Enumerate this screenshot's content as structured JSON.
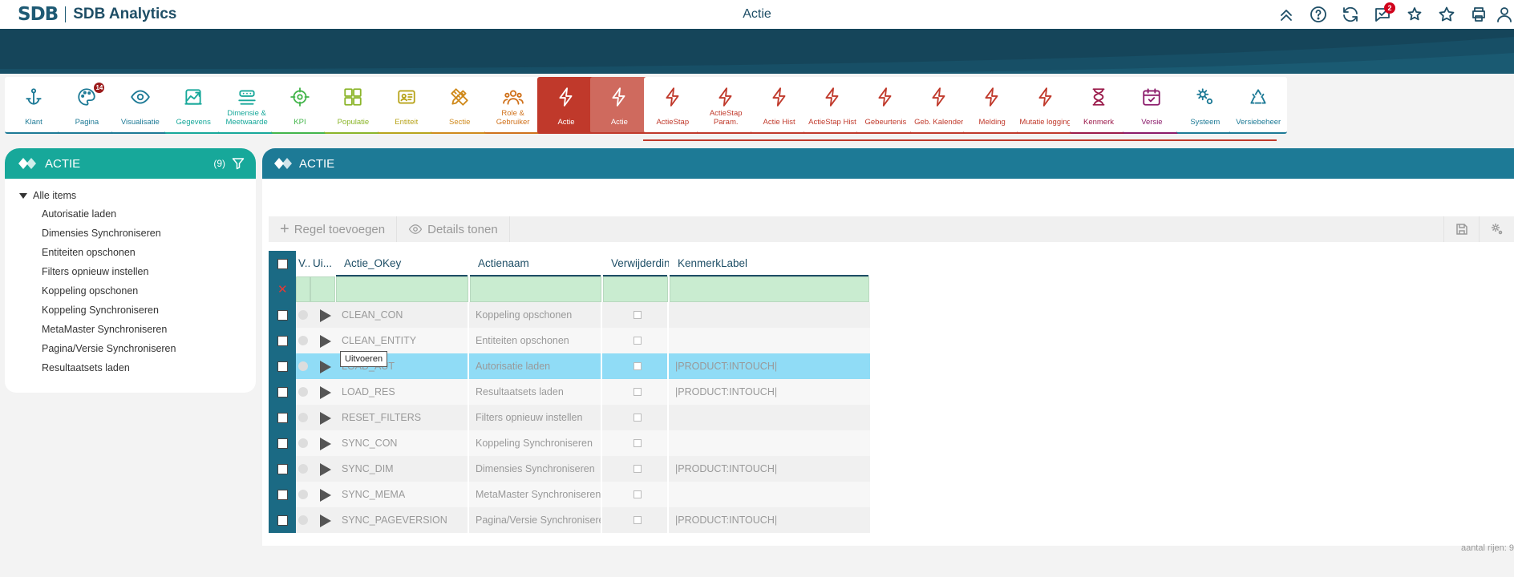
{
  "app": {
    "brand_mark": "SDB",
    "brand_name": "SDB Analytics",
    "page_title": "Actie"
  },
  "topbar": {
    "notification_count": "2"
  },
  "tiles": [
    {
      "label": "Klant",
      "color": "#1d7a96",
      "icon": "anchor-icon"
    },
    {
      "label": "Pagina",
      "color": "#1d7a96",
      "icon": "palette-icon",
      "badge": "14"
    },
    {
      "label": "Visualisatie",
      "color": "#1d7a96",
      "icon": "eye-icon"
    },
    {
      "label": "Gegevens",
      "color": "#17a89a",
      "icon": "chart-icon"
    },
    {
      "label": "Dimensie & Meetwaarde",
      "color": "#17a89a",
      "icon": "dimension-icon"
    },
    {
      "label": "KPI",
      "color": "#43b54b",
      "icon": "target-icon"
    },
    {
      "label": "Populatie",
      "color": "#8bb52a",
      "icon": "population-icon"
    },
    {
      "label": "Entiteit",
      "color": "#b8a41b",
      "icon": "id-card-icon"
    },
    {
      "label": "Sectie",
      "color": "#d08a1c",
      "icon": "pencil-ruler-icon"
    },
    {
      "label": "Role & Gebruiker",
      "color": "#d0721c",
      "icon": "users-icon"
    },
    {
      "label": "Actie",
      "color": "#c0392b",
      "icon": "bolt-icon",
      "state": "active"
    },
    {
      "label": "Actie",
      "color": "#c0392b",
      "icon": "bolt-icon",
      "state": "hover"
    },
    {
      "label": "ActieStap",
      "color": "#c0392b",
      "icon": "bolt-icon"
    },
    {
      "label": "ActieStap Param.",
      "color": "#c0392b",
      "icon": "bolt-icon"
    },
    {
      "label": "Actie Hist",
      "color": "#c0392b",
      "icon": "bolt-icon"
    },
    {
      "label": "ActieStap Hist",
      "color": "#c0392b",
      "icon": "bolt-icon"
    },
    {
      "label": "Gebeurtenis",
      "color": "#c0392b",
      "icon": "bolt-icon"
    },
    {
      "label": "Geb. Kalender",
      "color": "#c0392b",
      "icon": "bolt-icon"
    },
    {
      "label": "Melding",
      "color": "#c0392b",
      "icon": "bolt-icon"
    },
    {
      "label": "Mutatie logging",
      "color": "#c0392b",
      "icon": "bolt-icon"
    },
    {
      "label": "Kenmerk",
      "color": "#9b1b4b",
      "icon": "hourglass-icon"
    },
    {
      "label": "Versie",
      "color": "#8b1b6b",
      "icon": "calendar-check-icon"
    },
    {
      "label": "Systeem",
      "color": "#1d7a96",
      "icon": "gears-icon"
    },
    {
      "label": "Versiebeheer",
      "color": "#1d7a96",
      "icon": "recycle-icon"
    }
  ],
  "left_panel": {
    "title": "ACTIE",
    "count": "(9)",
    "root_label": "Alle items",
    "items": [
      "Autorisatie laden",
      "Dimensies Synchroniseren",
      "Entiteiten opschonen",
      "Filters opnieuw instellen",
      "Koppeling opschonen",
      "Koppeling Synchroniseren",
      "MetaMaster Synchroniseren",
      "Pagina/Versie Synchroniseren",
      "Resultaatsets laden"
    ]
  },
  "main_panel": {
    "title": "ACTIE",
    "toolbar": {
      "add_row": "Regel toevoegen",
      "show_details": "Details tonen"
    },
    "columns": [
      "V..",
      "Ui...",
      "Actie_OKey",
      "Actienaam",
      "Verwijderdin...",
      "KenmerkLabel"
    ],
    "rows": [
      {
        "okey": "CLEAN_CON",
        "name": "Koppeling opschonen",
        "label": ""
      },
      {
        "okey": "CLEAN_ENTITY",
        "name": "Entiteiten opschonen",
        "label": ""
      },
      {
        "okey": "LOAD_AUT",
        "name": "Autorisatie laden",
        "label": "|PRODUCT:INTOUCH|",
        "selected": true
      },
      {
        "okey": "LOAD_RES",
        "name": "Resultaatsets laden",
        "label": "|PRODUCT:INTOUCH|"
      },
      {
        "okey": "RESET_FILTERS",
        "name": "Filters opnieuw instellen",
        "label": ""
      },
      {
        "okey": "SYNC_CON",
        "name": "Koppeling Synchroniseren",
        "label": ""
      },
      {
        "okey": "SYNC_DIM",
        "name": "Dimensies Synchroniseren",
        "label": "|PRODUCT:INTOUCH|"
      },
      {
        "okey": "SYNC_MEMA",
        "name": "MetaMaster Synchroniseren",
        "label": ""
      },
      {
        "okey": "SYNC_PAGEVERSION",
        "name": "Pagina/Versie Synchroniseren",
        "label": "|PRODUCT:INTOUCH|"
      }
    ],
    "tooltip": "Uitvoeren",
    "row_count": "aantal rijen: 9"
  }
}
